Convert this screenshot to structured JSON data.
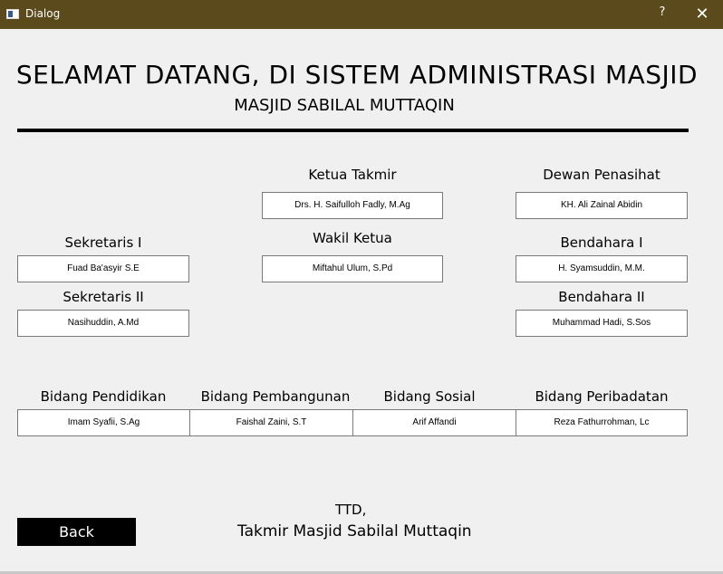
{
  "window": {
    "title": "Dialog",
    "help_label": "?",
    "close_label": "✕"
  },
  "header": {
    "title": "SELAMAT DATANG, DI SISTEM ADMINISTRASI MASJID",
    "subtitle": "MASJID SABILAL MUTTAQIN"
  },
  "org": {
    "ketua_takmir": {
      "label": "Ketua  Takmir",
      "value": "Drs. H. Saifulloh Fadly, M.Ag"
    },
    "dewan_penasihat": {
      "label": "Dewan Penasihat",
      "value": "KH. Ali Zainal Abidin"
    },
    "wakil_ketua": {
      "label": "Wakil Ketua",
      "value": "Miftahul Ulum, S.Pd"
    },
    "sekretaris_1": {
      "label": "Sekretaris I",
      "value": "Fuad Ba'asyir S.E"
    },
    "sekretaris_2": {
      "label": "Sekretaris II",
      "value": "Nasihuddin, A.Md"
    },
    "bendahara_1": {
      "label": "Bendahara I",
      "value": "H. Syamsuddin, M.M."
    },
    "bendahara_2": {
      "label": "Bendahara II",
      "value": "Muhammad Hadi, S.Sos"
    },
    "bidang_pendidikan": {
      "label": "Bidang Pendidikan",
      "value": "Imam Syafii, S.Ag"
    },
    "bidang_pembangunan": {
      "label": "Bidang Pembangunan",
      "value": "Faishal Zaini, S.T"
    },
    "bidang_sosial": {
      "label": "Bidang Sosial",
      "value": "Arif Affandi"
    },
    "bidang_peribadatan": {
      "label": "Bidang Peribadatan",
      "value": "Reza Fathurrohman, Lc"
    }
  },
  "footer": {
    "ttd": "TTD,",
    "signature": "Takmir Masjid Sabilal Muttaqin",
    "back_label": "Back"
  }
}
